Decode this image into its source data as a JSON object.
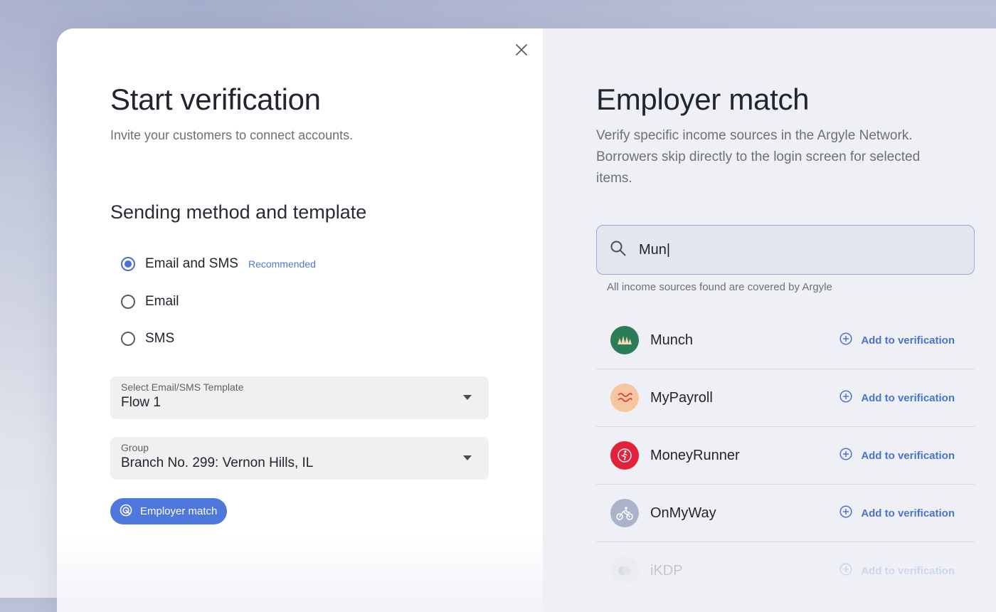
{
  "start": {
    "title": "Start verification",
    "subtitle": "Invite your customers to connect accounts.",
    "section_title": "Sending method and template",
    "methods": [
      {
        "label": "Email and SMS",
        "badge": "Recommended",
        "selected": true
      },
      {
        "label": "Email",
        "selected": false
      },
      {
        "label": "SMS",
        "selected": false
      }
    ],
    "template_select": {
      "label": "Select Email/SMS Template",
      "value": "Flow 1"
    },
    "group_select": {
      "label": "Group",
      "value": "Branch No. 299: Vernon Hills, IL"
    },
    "employer_match_button": "Employer match"
  },
  "match": {
    "title": "Employer match",
    "description": "Verify specific income sources in the Argyle Network. Borrowers skip directly to the login screen for selected items.",
    "search": {
      "value": "Mun|"
    },
    "note": "All income sources found are covered by Argyle",
    "add_label": "Add to verification",
    "results": [
      {
        "name": "Munch",
        "icon": "munch-logo-icon",
        "color": "#2b7d58"
      },
      {
        "name": "MyPayroll",
        "icon": "mypayroll-logo-icon",
        "color": "#f6c6a0"
      },
      {
        "name": "MoneyRunner",
        "icon": "moneyrunner-logo-icon",
        "color": "#e3213a"
      },
      {
        "name": "OnMyWay",
        "icon": "onmyway-logo-icon",
        "color": "#aab3ca"
      },
      {
        "name": "iKDP",
        "icon": "ikdp-logo-icon",
        "color": "#9aa0ad"
      }
    ]
  },
  "colors": {
    "accent": "#4e78dc",
    "link": "#4a72d4"
  }
}
